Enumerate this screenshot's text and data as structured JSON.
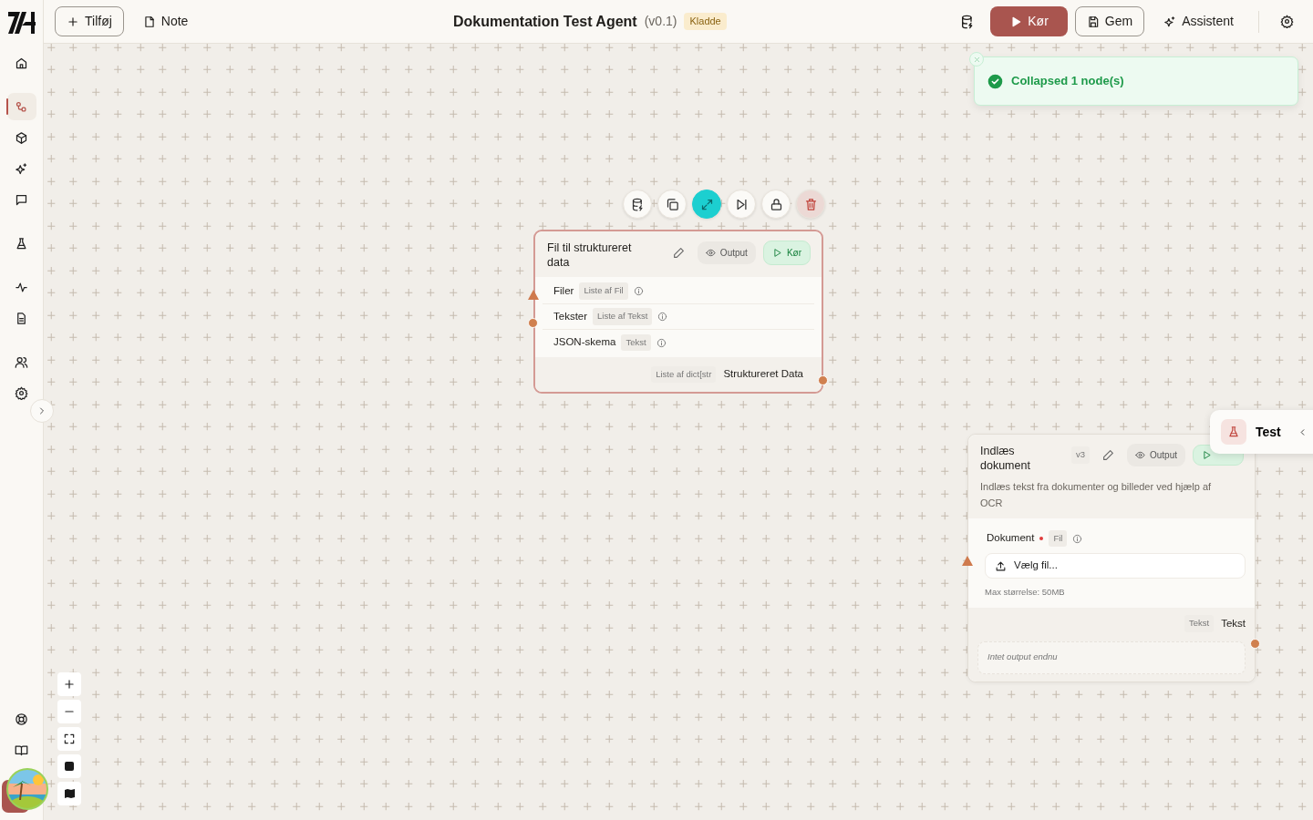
{
  "header": {
    "add_button": "Tilføj",
    "note_button": "Note",
    "title": "Dokumentation Test Agent",
    "version": "(v0.1)",
    "status_badge": "Kladde",
    "run_button": "Kør",
    "save_button": "Gem",
    "assistant_button": "Assistent"
  },
  "sidebar": {
    "items": [
      {
        "selected": false
      },
      {
        "selected": true
      },
      {
        "selected": false
      },
      {
        "selected": false
      },
      {
        "selected": false
      },
      {
        "selected": false
      },
      {
        "selected": false
      },
      {
        "selected": false
      },
      {
        "selected": false
      },
      {
        "selected": false
      }
    ]
  },
  "toast": {
    "message": "Collapsed 1 node(s)"
  },
  "nodes": [
    {
      "title": "Fil til struktureret data",
      "selected": true,
      "output_button": "Output",
      "run_button": "Kør",
      "inputs": [
        {
          "name": "Filer",
          "type": "Liste af Fil",
          "kind": "triangle",
          "required": false
        },
        {
          "name": "Tekster",
          "type": "Liste af Tekst",
          "kind": "dot",
          "required": false
        },
        {
          "name": "JSON-skema",
          "type": "Tekst",
          "kind": "none",
          "required": false
        }
      ],
      "output": {
        "type": "Liste af dict[str",
        "name": "Struktureret Data"
      }
    },
    {
      "title": "Indlæs dokument",
      "version": "v3",
      "description": "Indlæs tekst fra dokumenter og billeder ved hjælp af OCR",
      "selected": false,
      "output_button": "Output",
      "inputs": [
        {
          "name": "Dokument",
          "type": "Fil",
          "kind": "triangle",
          "required": true,
          "upload_button": "Vælg fil...",
          "hint": "Max størrelse: 50MB"
        }
      ],
      "output": {
        "type": "Tekst",
        "name": "Tekst",
        "placeholder": "Intet output endnu"
      }
    }
  ],
  "test_panel": {
    "label": "Test"
  }
}
